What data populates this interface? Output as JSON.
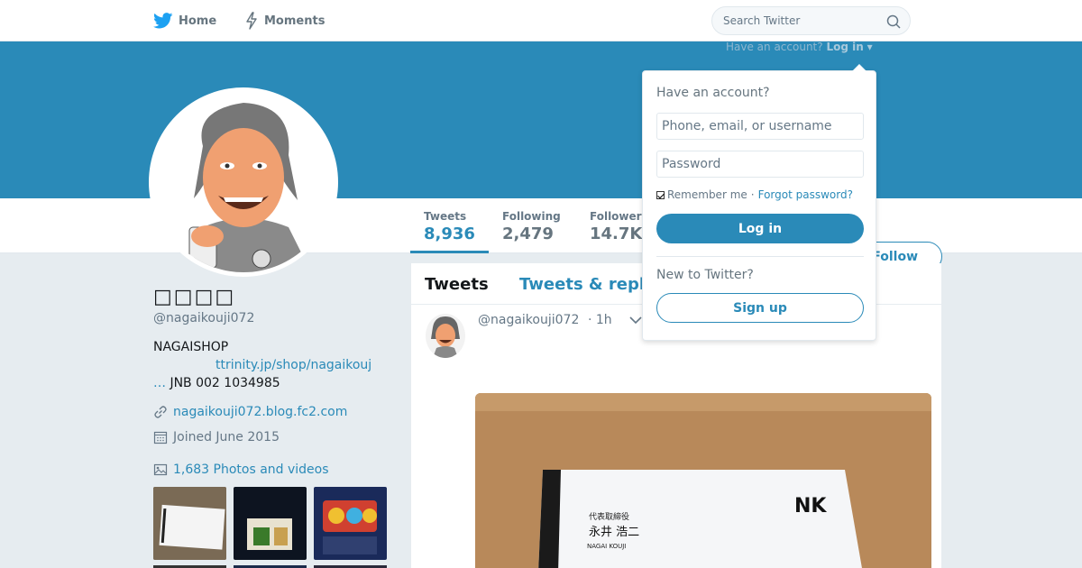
{
  "nav": {
    "home_label": "Home",
    "moments_label": "Moments",
    "search_placeholder": "Search Twitter"
  },
  "account_prompt": {
    "question": "Have an account?",
    "login_link": "Log in"
  },
  "profile_stats": [
    {
      "label": "Tweets",
      "value": "8,936"
    },
    {
      "label": "Following",
      "value": "2,479"
    },
    {
      "label": "Followers",
      "value": "14.7K"
    }
  ],
  "follow_label": "Follow",
  "profile": {
    "name": "□□□□",
    "handle": "@nagaikouji072",
    "bio_line1": "NAGAISHOP",
    "bio_link": "ttrinity.jp/shop/nagaikouj",
    "bio_ellipsis": "…",
    "bio_line3": "JNB 002 1034985",
    "website": "nagaikouji072.blog.fc2.com",
    "joined": "Joined June 2015",
    "photos_label": "1,683 Photos and videos"
  },
  "timeline": {
    "tab_tweets": "Tweets",
    "tab_replies": "Tweets & replies"
  },
  "tweet": {
    "handle": "@nagaikouji072",
    "time": "· 1h",
    "card_title": "代表取締役",
    "card_name": "永井 浩二",
    "card_romaji": "NAGAI KOUJI",
    "card_logo": "NK"
  },
  "login_dropdown": {
    "title": "Have an account?",
    "username_placeholder": "Phone, email, or username",
    "password_placeholder": "Password",
    "remember_label": "Remember me",
    "separator": "·",
    "forgot_label": "Forgot password?",
    "login_button": "Log in",
    "new_label": "New to Twitter?",
    "signup_button": "Sign up"
  },
  "colors": {
    "accent": "#2a8ab8",
    "background": "#e6ecf0"
  }
}
